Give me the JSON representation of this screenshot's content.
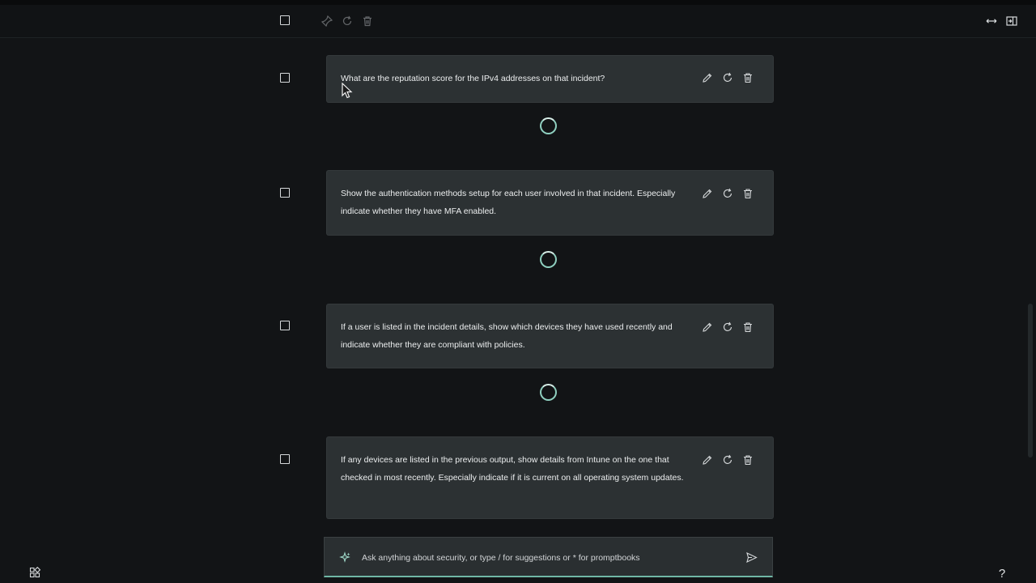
{
  "toolbar": {
    "select_all_label": "",
    "icons": [
      "pin-icon",
      "refresh-icon",
      "trash-icon"
    ],
    "right_icons": [
      "collapse-horizontal-icon",
      "side-panel-icon"
    ]
  },
  "prompts": [
    {
      "text": "What are the reputation score for the IPv4 addresses on that incident?",
      "status": "loading"
    },
    {
      "text": "Show the authentication methods setup for each user involved in that incident. Especially indicate whether they have MFA enabled.",
      "status": "loading"
    },
    {
      "text": "If a user is listed in the incident details, show which devices they have used recently and indicate whether they are compliant with policies.",
      "status": "loading"
    },
    {
      "text": "If any devices are listed in the previous output, show details from Intune on the one that checked in most recently. Especially indicate if it is current on all operating system updates.",
      "status": "pending"
    }
  ],
  "composer": {
    "placeholder": "Ask anything about security, or type / for suggestions or * for promptbooks"
  },
  "footer": {
    "help_label": "?"
  },
  "colors": {
    "background": "#121416",
    "card": "#2c3133",
    "accent": "#6fb7a5"
  }
}
